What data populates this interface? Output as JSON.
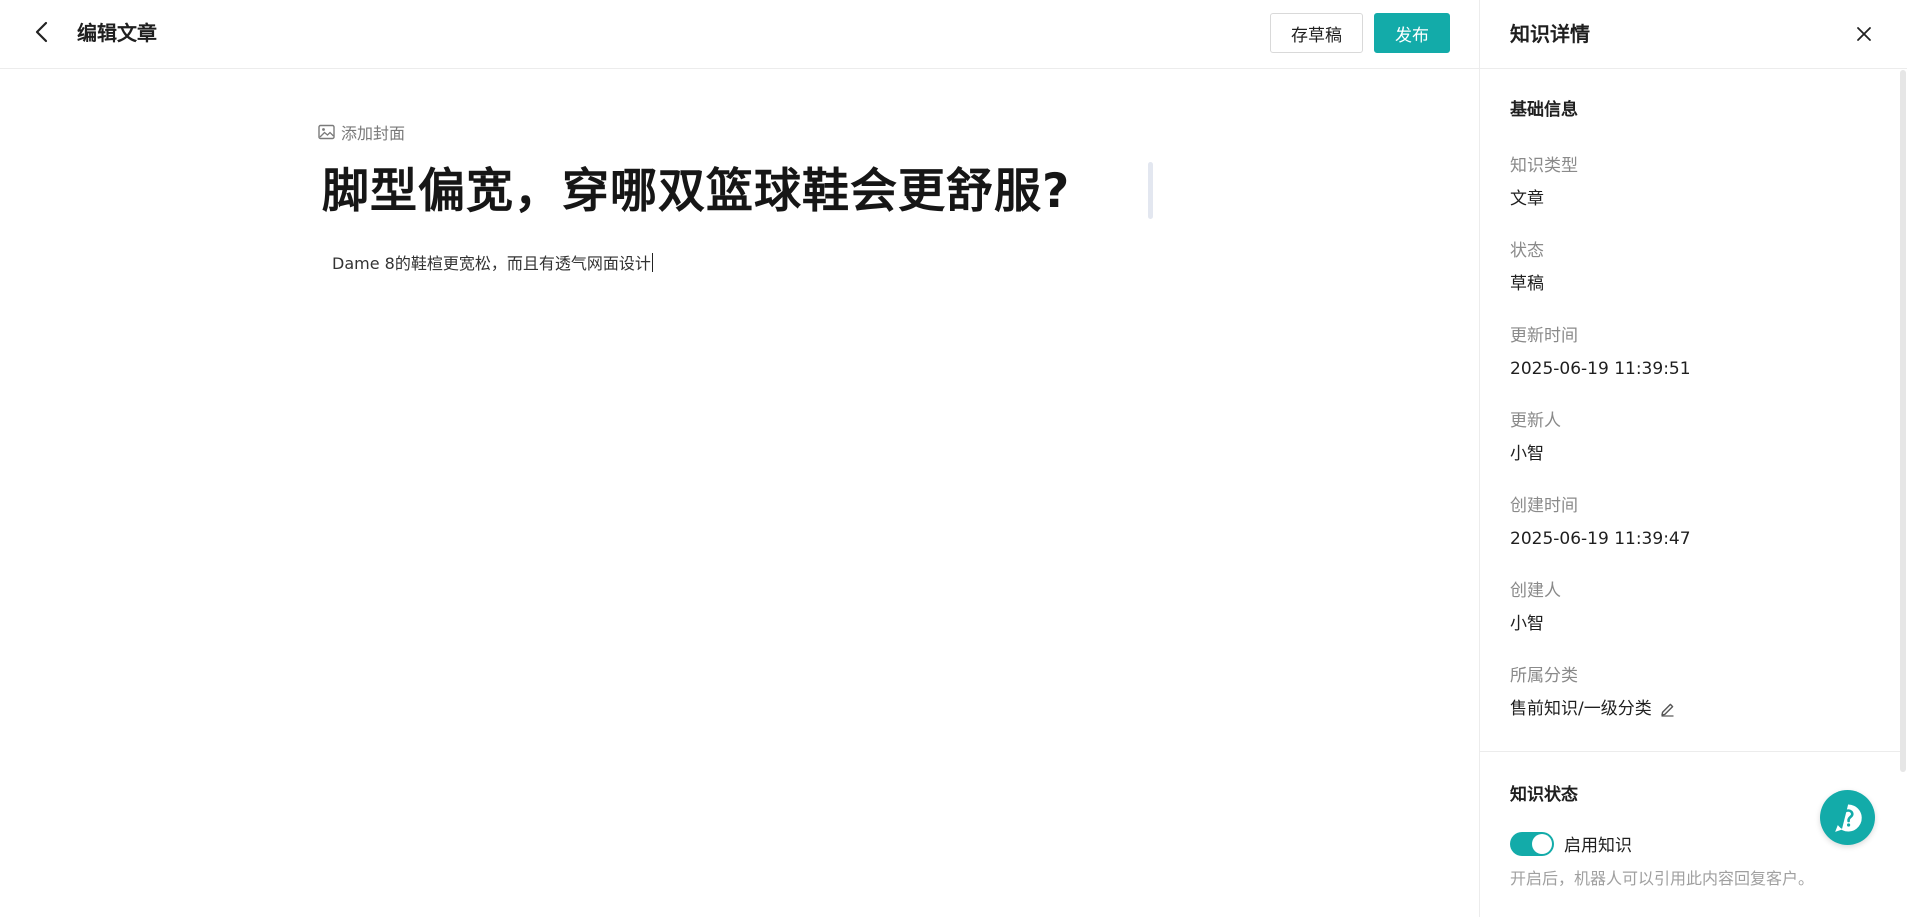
{
  "header": {
    "title": "编辑文章",
    "save_draft_label": "存草稿",
    "publish_label": "发布"
  },
  "editor": {
    "add_cover_label": "添加封面",
    "article_title": "脚型偏宽，穿哪双篮球鞋会更舒服?",
    "body_text": "Dame 8的鞋楦更宽松，而且有透气网面设计"
  },
  "panel": {
    "title": "知识详情",
    "basic_section_title": "基础信息",
    "fields": [
      {
        "label": "知识类型",
        "value": "文章"
      },
      {
        "label": "状态",
        "value": "草稿"
      },
      {
        "label": "更新时间",
        "value": "2025-06-19 11:39:51"
      },
      {
        "label": "更新人",
        "value": "小智"
      },
      {
        "label": "创建时间",
        "value": "2025-06-19 11:39:47"
      },
      {
        "label": "创建人",
        "value": "小智"
      },
      {
        "label": "所属分类",
        "value": "售前知识/一级分类"
      }
    ],
    "status_section_title": "知识状态",
    "toggle_label": "启用知识",
    "toggle_on": true,
    "hint": "开启后，机器人可以引用此内容回复客户。"
  },
  "icons": {
    "back": "chevron-left-icon",
    "cover": "image-icon",
    "close": "close-icon",
    "edit": "pencil-icon",
    "help": "question-icon"
  },
  "colors": {
    "accent": "#13aba9",
    "label_gray": "#8a8a8a",
    "hint_gray": "#a0a0a0"
  }
}
